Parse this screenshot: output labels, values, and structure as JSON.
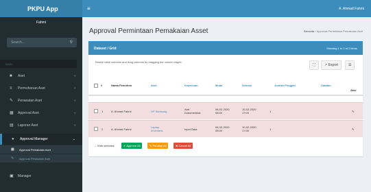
{
  "app": {
    "title": "PKPU App"
  },
  "header": {
    "user": "A. Ahmad Fahmi",
    "menu_icon": "hamburger-icon"
  },
  "sidebar": {
    "user_name": "Fahmi",
    "search_placeholder": "Search...",
    "section_label": "MAIN",
    "items": [
      {
        "label": "Aset",
        "icon": "cube-icon"
      },
      {
        "label": "Permohonan Aset",
        "icon": "list-icon"
      },
      {
        "label": "Perawatan Aset",
        "icon": "wrench-icon"
      },
      {
        "label": "Approval Aset",
        "icon": "table-icon"
      },
      {
        "label": "Laporan Aset",
        "icon": "book-icon"
      },
      {
        "label": "Approval Manager",
        "icon": "circle-icon"
      }
    ],
    "sub_items": [
      {
        "label": "Approval Pemakaian Aset",
        "icon": "table-icon"
      },
      {
        "label": "Approval Perawatan Aset",
        "icon": "wrench-icon"
      }
    ],
    "last_item": {
      "label": "Manager",
      "icon": "users-icon"
    }
  },
  "page": {
    "title": "Approval Permintaan Pemakaian Asset",
    "breadcrumb_home": "Beranda",
    "breadcrumb_current": "Approval Permintaan Pemakaian Aset"
  },
  "box": {
    "title": "Dataset / Grid",
    "info": "Showing 1 to 2 of 2 items",
    "hint": "Resize table columns and drag columns by dragging the column edges",
    "tool_fullscreen": "⛶",
    "tool_export": "Export",
    "tool_toggle": "☰"
  },
  "table": {
    "columns": [
      "#",
      "Nama Pemohon",
      "Aset",
      "Keperluan",
      "Mulai",
      "Selesai",
      "Jumlah Pinggan",
      "Catatan",
      "Aksi"
    ],
    "rows": [
      {
        "no": "1",
        "pemohon": "A. Ahmad Fahmi",
        "aset": "HP Samsung",
        "keperluan": "Alat Dokumentasi",
        "mulai": "06-02-2020 08:00",
        "selesai": "10-02-2020 17:00",
        "jumlah": "1",
        "catatan": "",
        "aksi": "✎"
      },
      {
        "no": "2",
        "pemohon": "A. Ahmad Fahmi",
        "aset": "Laptop Inventaris",
        "keperluan": "Input Data",
        "mulai": "06-02-2020 08:00",
        "selesai": "10-02-2020 17:00",
        "jumlah": "1",
        "catatan": "",
        "aksi": "✎"
      }
    ]
  },
  "actions": {
    "label": "With selected:",
    "approve": "Approve All",
    "pending": "Pending All",
    "cancel": "Cancel All"
  },
  "colors": {
    "header": "#3c8dbc",
    "logo": "#367fa9",
    "sidebar": "#222d32",
    "row_highlight": "#f2dede",
    "approve": "#00a65a",
    "pending": "#f39c12",
    "cancel": "#dd4b39"
  }
}
